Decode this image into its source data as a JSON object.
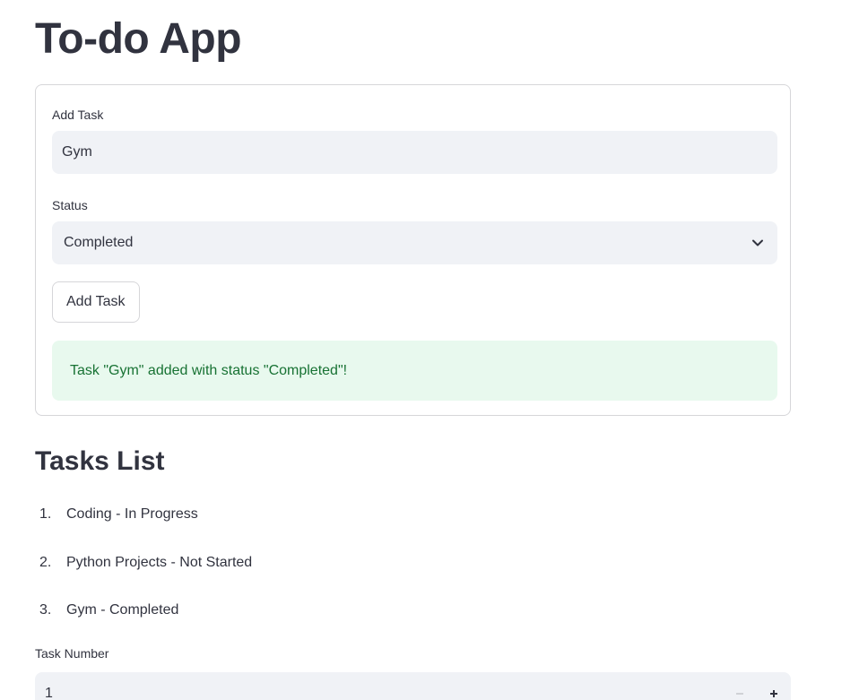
{
  "app": {
    "title": "To-do App"
  },
  "add_form": {
    "task_label": "Add Task",
    "task_value": "Gym",
    "status_label": "Status",
    "status_selected": "Completed",
    "submit_label": "Add Task",
    "success_message": "Task \"Gym\" added with status \"Completed\"!",
    "success_color": "#177233",
    "success_bg": "#e8f9ee"
  },
  "tasks": {
    "title": "Tasks List",
    "items": [
      {
        "number": "1.",
        "text": "Coding - In Progress"
      },
      {
        "number": "2.",
        "text": "Python Projects - Not Started"
      },
      {
        "number": "3.",
        "text": "Gym - Completed"
      }
    ]
  },
  "task_number": {
    "label": "Task Number",
    "value": "1",
    "decrement_icon": "minus-icon",
    "increment_icon": "plus-icon"
  },
  "icons": {
    "status_dropdown": "chevron-down-icon"
  }
}
